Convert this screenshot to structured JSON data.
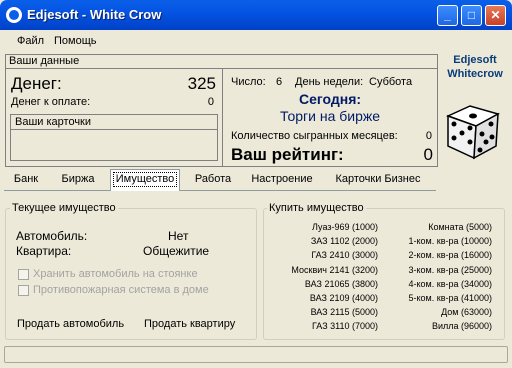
{
  "window": {
    "title": "Edjesoft - White Crow"
  },
  "menu": [
    {
      "label": "Файл"
    },
    {
      "label": "Помощь"
    }
  ],
  "user_data": {
    "title": "Ваши данные",
    "money_label": "Денег:",
    "money_value": "325",
    "debt_label": "Денег к оплате:",
    "debt_value": "0",
    "cards_title": "Ваши карточки"
  },
  "status": {
    "day_label": "Число:",
    "day_value": "6",
    "weekday_label": "День недели:",
    "weekday_value": "Суббота",
    "today_title": "Сегодня:",
    "today_event": "Торги на бирже",
    "months_label": "Количество сыгранных месяцев:",
    "months_value": "0",
    "rating_label": "Ваш рейтинг:",
    "rating_value": "0"
  },
  "brand": {
    "line1": "Edjesoft",
    "line2": "Whitecrow"
  },
  "tabs": [
    {
      "label": "Банк"
    },
    {
      "label": "Биржа"
    },
    {
      "label": "Имущество"
    },
    {
      "label": "Работа"
    },
    {
      "label": "Настроение"
    },
    {
      "label": "Карточки Бизнес"
    }
  ],
  "current_property": {
    "title": "Текущее имущество",
    "car_label": "Автомобиль:",
    "car_value": "Нет",
    "flat_label": "Квартира:",
    "flat_value": "Общежитие",
    "opt_parking": "Хранить автомобиль на стоянке",
    "opt_fire": "Противопожарная система в доме",
    "sell_car": "Продать автомобиль",
    "sell_flat": "Продать квартиру"
  },
  "buy_property": {
    "title": "Купить имущество",
    "cars": [
      "Луаз-969 (1000)",
      "ЗАЗ 1102 (2000)",
      "ГАЗ 2410 (3000)",
      "Москвич 2141 (3200)",
      "ВАЗ 21065 (3800)",
      "ВАЗ 2109 (4000)",
      "ВАЗ 2115 (5000)",
      "ГАЗ 3110 (7000)"
    ],
    "flats": [
      "Комната (5000)",
      "1-ком. кв-ра (10000)",
      "2-ком. кв-ра (16000)",
      "3-ком. кв-ра (25000)",
      "4-ком. кв-ра (34000)",
      "5-ком. кв-ра (41000)",
      "Дом (63000)",
      "Вилла (96000)"
    ]
  }
}
